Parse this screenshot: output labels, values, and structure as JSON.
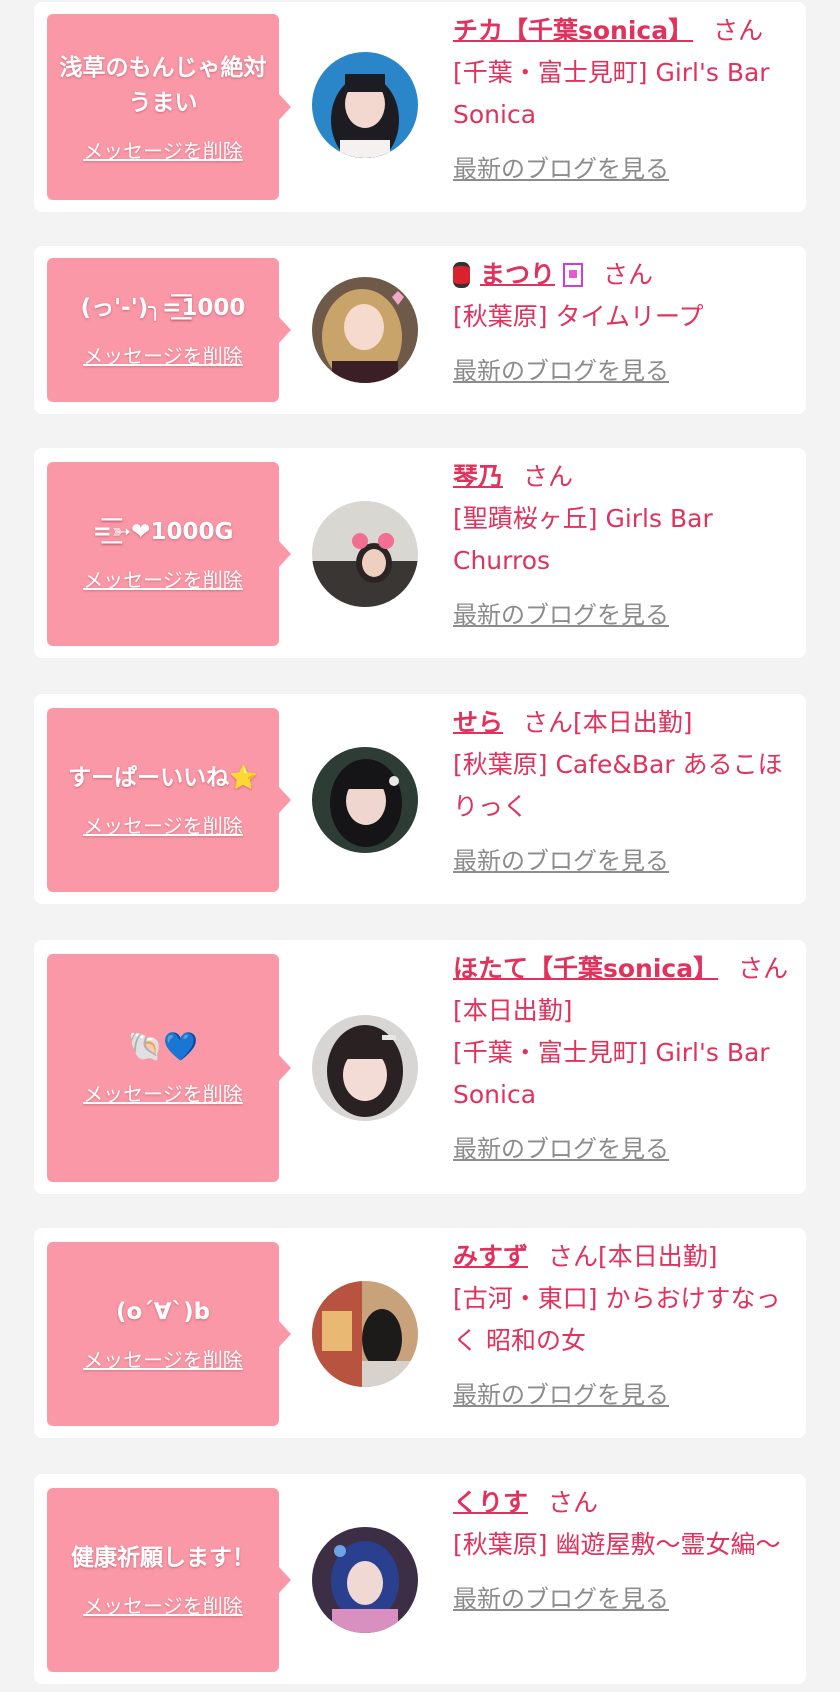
{
  "common": {
    "delete_label": "メッセージを削除",
    "blog_label": "最新のブログを見る"
  },
  "cards": [
    {
      "message": "浅草のもんじゃ絶対うまい",
      "name": "チカ【千葉sonica】",
      "suffix": "さん",
      "shop": "[千葉・富士見町] Girl's Bar Sonica"
    },
    {
      "message": "(っ'-')╮=͟͟͞͞1000",
      "name": "まつり",
      "suffix": "さん",
      "shop": "[秋葉原] タイムリープ"
    },
    {
      "message": "=͟͟͞͞➳❤1000G",
      "name": "琴乃",
      "suffix": "さん",
      "shop": "[聖蹟桜ヶ丘] Girls Bar Churros"
    },
    {
      "message": "すーぱーいいね⭐️",
      "name": "せら",
      "suffix": "さん[本日出勤]",
      "shop": "[秋葉原] Cafe&Bar あるこほりっく"
    },
    {
      "message": "🐚💙",
      "name": "ほたて【千葉sonica】",
      "suffix": "さん[本日出勤]",
      "shop": "[千葉・富士見町] Girl's Bar Sonica"
    },
    {
      "message": "(o´∀`)b",
      "name": "みすず",
      "suffix": "さん[本日出勤]",
      "shop": "[古河・東口] からおけすなっく 昭和の女"
    },
    {
      "message": "健康祈願します！",
      "name": "くりす",
      "suffix": "さん",
      "shop": "[秋葉原] 幽遊屋敷〜霊女編〜"
    }
  ],
  "colors": {
    "page_bg": "#f3f3f3",
    "card_bg": "#ffffff",
    "bubble_bg": "#fa98a7",
    "accent": "#e0325c",
    "blog_link": "#8c8c8c"
  },
  "icons": [
    "lantern-icon",
    "tag-icon",
    "heart-icon",
    "star-icon",
    "shell-icon"
  ]
}
